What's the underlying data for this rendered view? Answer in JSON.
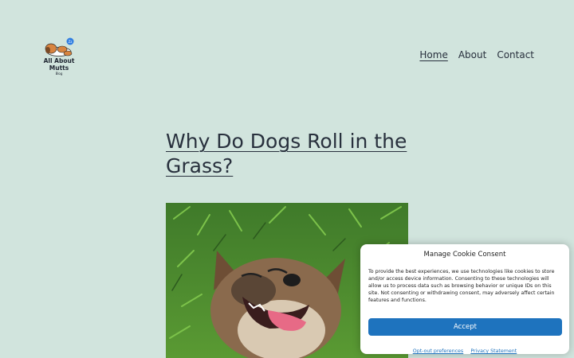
{
  "site": {
    "logo": {
      "line1": "All About",
      "line2": "Mutts",
      "line3": "Blog"
    }
  },
  "nav": {
    "items": [
      {
        "label": "Home",
        "active": true
      },
      {
        "label": "About",
        "active": false
      },
      {
        "label": "Contact",
        "active": false
      }
    ]
  },
  "post": {
    "title": "Why Do Dogs Roll in the Grass?"
  },
  "cookie": {
    "heading": "Manage Cookie Consent",
    "message": "To provide the best experiences, we use technologies like cookies to store and/or access device information. Consenting to these technologies will allow us to process data such as browsing behavior or unique IDs on this site. Not consenting or withdrawing consent, may adversely affect certain features and functions.",
    "accept_label": "Accept",
    "opt_out_label": "Opt-out preferences",
    "privacy_label": "Privacy Statement",
    "accent": "#1e73be"
  },
  "colors": {
    "background": "#d1e4dd",
    "text": "#28303d"
  },
  "icons": {
    "logo": "sleeping-dog-icon",
    "featured": "dog-rolling-in-grass-photo"
  }
}
